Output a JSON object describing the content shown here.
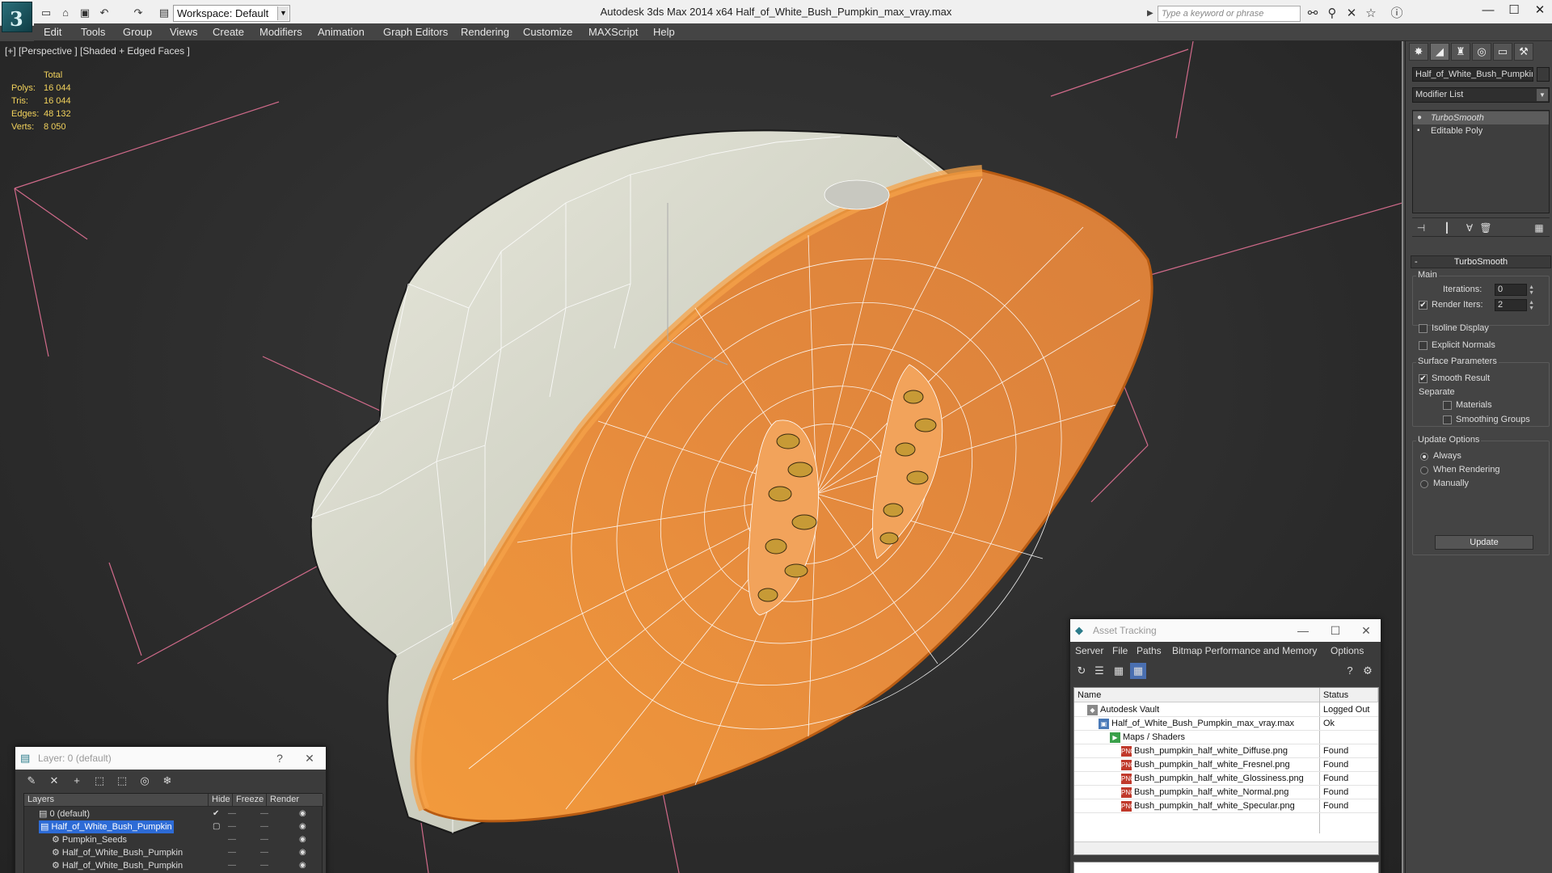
{
  "app": {
    "window_title": "Autodesk 3ds Max  2014 x64      Half_of_White_Bush_Pumpkin_max_vray.max",
    "workspace": "Workspace: Default",
    "search_placeholder": "Type a keyword or phrase"
  },
  "menu": [
    "Edit",
    "Tools",
    "Group",
    "Views",
    "Create",
    "Modifiers",
    "Animation",
    "Graph Editors",
    "Rendering",
    "Customize",
    "MAXScript",
    "Help"
  ],
  "viewport": {
    "label": "[+] [Perspective ] [Shaded + Edged Faces ]",
    "stats_header": "Total",
    "stats": [
      {
        "key": "Polys:",
        "value": "16 044"
      },
      {
        "key": "Tris:",
        "value": "16 044"
      },
      {
        "key": "Edges:",
        "value": "48 132"
      },
      {
        "key": "Verts:",
        "value": "8 050"
      }
    ],
    "pumpkin_flesh_color": "#e98a2e",
    "pumpkin_skin_color": "#dcdccf"
  },
  "command_panel": {
    "object_name": "Half_of_White_Bush_Pumpkin",
    "modifier_list": "Modifier List",
    "stack": [
      "TurboSmooth",
      "Editable Poly"
    ],
    "rollout_title": "TurboSmooth",
    "main_group": "Main",
    "iterations_label": "Iterations:",
    "iterations_value": "0",
    "render_iters_label": "Render Iters:",
    "render_iters_value": "2",
    "isoline": "Isoline Display",
    "explicit_normals": "Explicit Normals",
    "surface_group": "Surface Parameters",
    "smooth_result": "Smooth Result",
    "separate": "Separate",
    "materials": "Materials",
    "smoothing_groups": "Smoothing Groups",
    "update_group": "Update Options",
    "always": "Always",
    "when_rendering": "When Rendering",
    "manually": "Manually",
    "update_button": "Update"
  },
  "layer_panel": {
    "title": "Layer: 0 (default)",
    "help": "?",
    "columns": [
      "Layers",
      "Hide",
      "Freeze",
      "Render"
    ],
    "rows": [
      "0 (default)",
      "Half_of_White_Bush_Pumpkin",
      "Pumpkin_Seeds",
      "Half_of_White_Bush_Pumpkin",
      "Half_of_White_Bush_Pumpkin"
    ]
  },
  "asset_panel": {
    "title": "Asset Tracking",
    "menu": [
      "Server",
      "File",
      "Paths",
      "Bitmap Performance and Memory",
      "Options"
    ],
    "columns": [
      "Name",
      "Status"
    ],
    "rows": [
      {
        "name": "Autodesk Vault",
        "status": "Logged Out"
      },
      {
        "name": "Half_of_White_Bush_Pumpkin_max_vray.max",
        "status": "Ok"
      },
      {
        "name": "Maps / Shaders",
        "status": ""
      },
      {
        "name": "Bush_pumpkin_half_white_Diffuse.png",
        "status": "Found"
      },
      {
        "name": "Bush_pumpkin_half_white_Fresnel.png",
        "status": "Found"
      },
      {
        "name": "Bush_pumpkin_half_white_Glossiness.png",
        "status": "Found"
      },
      {
        "name": "Bush_pumpkin_half_white_Normal.png",
        "status": "Found"
      },
      {
        "name": "Bush_pumpkin_half_white_Specular.png",
        "status": "Found"
      }
    ],
    "png_badge": "PNG"
  }
}
